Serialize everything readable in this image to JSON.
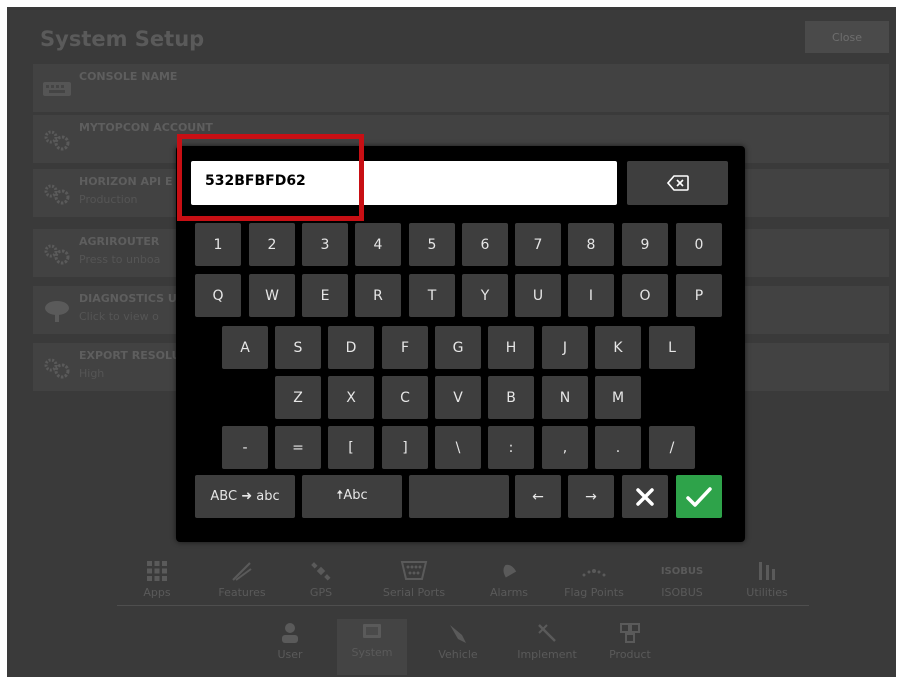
{
  "header": {
    "title": "System Setup",
    "close_label": "Close"
  },
  "settings": [
    {
      "name": "CONSOLE NAME",
      "value": "",
      "icon": "keyboard-icon"
    },
    {
      "name": "MYTOPCON ACCOUNT",
      "value": "",
      "icon": "gears-icon"
    },
    {
      "name": "HORIZON API E",
      "value": "Production",
      "icon": "gears-icon"
    },
    {
      "name": "AGRIROUTER",
      "value": "Press to unboa",
      "icon": "gears-icon"
    },
    {
      "name": "DIAGNOSTICS U",
      "value": "Click to view o",
      "icon": "cloud-upload-icon"
    },
    {
      "name": "EXPORT RESOLU",
      "value": "High",
      "icon": "gears-icon"
    }
  ],
  "nav_top": [
    {
      "label": "Apps",
      "icon": "apps-grid-icon"
    },
    {
      "label": "Features",
      "icon": "features-icon"
    },
    {
      "label": "GPS",
      "icon": "gps-satellite-icon"
    },
    {
      "label": "Serial Ports",
      "icon": "serial-port-icon"
    },
    {
      "label": "Alarms",
      "icon": "alarm-bell-icon"
    },
    {
      "label": "Flag Points",
      "icon": "flag-points-icon"
    },
    {
      "label": "ISOBUS",
      "icon": "isobus-icon",
      "icon_text": "ISOBUS"
    },
    {
      "label": "Utilities",
      "icon": "utilities-icon"
    }
  ],
  "nav_bottom": [
    {
      "label": "User",
      "icon": "user-icon"
    },
    {
      "label": "System",
      "icon": "system-console-icon",
      "active": true
    },
    {
      "label": "Vehicle",
      "icon": "vehicle-icon"
    },
    {
      "label": "Implement",
      "icon": "implement-icon"
    },
    {
      "label": "Product",
      "icon": "product-icon"
    }
  ],
  "keyboard": {
    "input_value": "532BFBFD62",
    "backspace_icon": "backspace-icon",
    "rows": [
      [
        "1",
        "2",
        "3",
        "4",
        "5",
        "6",
        "7",
        "8",
        "9",
        "0"
      ],
      [
        "Q",
        "W",
        "E",
        "R",
        "T",
        "Y",
        "U",
        "I",
        "O",
        "P"
      ],
      [
        "A",
        "S",
        "D",
        "F",
        "G",
        "H",
        "J",
        "K",
        "L"
      ],
      [
        "Z",
        "X",
        "C",
        "V",
        "B",
        "N",
        "M"
      ],
      [
        "-",
        "=",
        "[",
        "]",
        "\\",
        ":",
        ",",
        ".",
        "/"
      ]
    ],
    "bottom": {
      "case_toggle_label": "ABC ➜ abc",
      "shift_label": "🠅Abc",
      "space_label": "",
      "left_arrow": "←",
      "right_arrow": "→",
      "cancel_icon": "close-x-icon",
      "confirm_icon": "checkmark-icon"
    }
  },
  "colors": {
    "confirm": "#2ea34a",
    "highlight": "#c80f14",
    "key": "#3e3e3e",
    "keyboard_bg": "#000000"
  }
}
